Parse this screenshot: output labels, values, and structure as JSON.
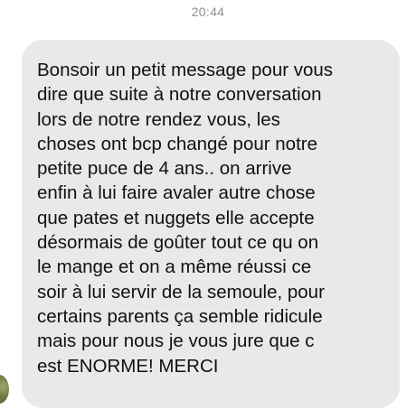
{
  "conversation": {
    "timestamp": "20:44",
    "messages": [
      {
        "direction": "incoming",
        "text": "Bonsoir un petit message pour vous\ndire que suite à notre conversation\nlors de notre rendez vous, les\nchoses ont bcp changé pour notre\npetite puce de 4 ans.. on arrive\nenfin à lui faire avaler autre chose\nque pates et nuggets elle accepte\ndésormais de goûter tout ce qu on\nle mange et on a même réussi ce\nsoir à lui servir de la semoule, pour\ncertains parents ça semble ridicule\nmais pour nous je vous jure que c\nest ENORME! MERCI"
      }
    ]
  },
  "colors": {
    "bubble_background": "#e9e9eb",
    "timestamp_text": "#8e8e93",
    "message_text": "#111111"
  }
}
